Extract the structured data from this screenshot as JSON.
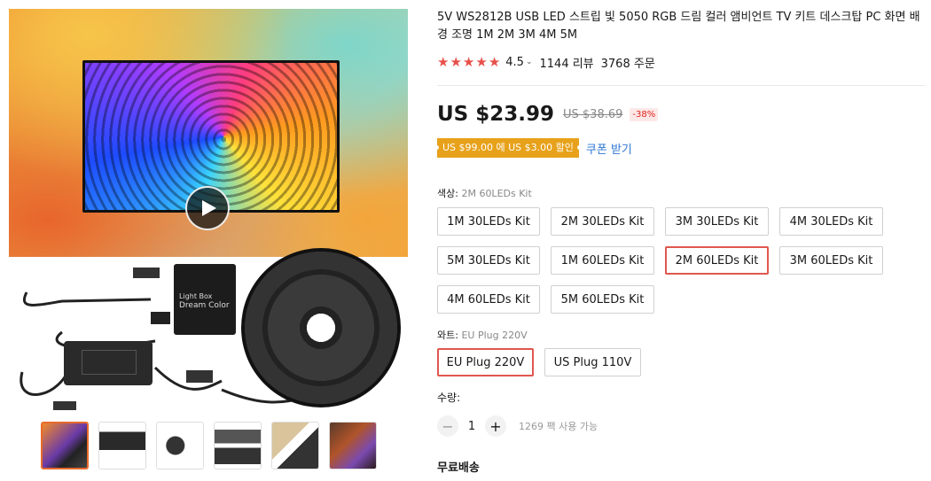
{
  "gallery": {
    "thumbnails": [
      "thumb-1",
      "thumb-2",
      "thumb-3",
      "thumb-4",
      "thumb-5",
      "thumb-6"
    ],
    "box_label_line1": "Light Box",
    "box_label_line2": "Dream Color"
  },
  "product": {
    "title": "5V WS2812B USB LED 스트립 빛 5050 RGB 드림 컬러 앰비언트 TV 키트 데스크탑 PC 화면 배경 조명 1M 2M 3M 4M 5M",
    "rating": "4.5",
    "rating_chevron": "⌄",
    "reviews": "1144 리뷰",
    "orders": "3768 주문",
    "price": "US $23.99",
    "original_price": "US $38.69",
    "discount": "-38%",
    "coupon": "US $99.00 에 US $3.00 할인",
    "coupon_link": "쿠폰 받기",
    "star_color": "#e8504a",
    "accent_color": "#e0574f"
  },
  "color_option": {
    "label": "색상:",
    "selected": "2M 60LEDs Kit",
    "options": [
      "1M 30LEDs Kit",
      "2M 30LEDs Kit",
      "3M 30LEDs Kit",
      "4M 30LEDs Kit",
      "5M 30LEDs Kit",
      "1M 60LEDs Kit",
      "2M 60LEDs Kit",
      "3M 60LEDs Kit",
      "4M 60LEDs Kit",
      "5M 60LEDs Kit"
    ]
  },
  "plug_option": {
    "label": "와트:",
    "selected": "EU Plug 220V",
    "options": [
      "EU Plug 220V",
      "US Plug 110V"
    ]
  },
  "quantity": {
    "label": "수량:",
    "minus": "−",
    "value": "1",
    "plus": "+",
    "stock": "1269 팩 사용 가능"
  },
  "shipping": {
    "label": "무료배송"
  }
}
